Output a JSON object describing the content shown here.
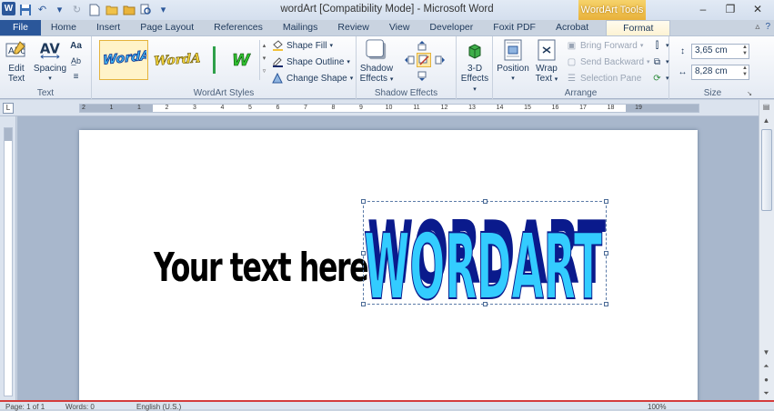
{
  "window": {
    "title": "wordArt [Compatibility Mode]  -  Microsoft Word",
    "contextual_tab_group": "WordArt Tools",
    "min_label": "–",
    "restore_label": "❐",
    "close_label": "✕"
  },
  "qat": {
    "app_icon": "W",
    "save_icon": "💾",
    "undo_icon": "↶",
    "redo_icon": "↻",
    "new_icon": "🗋",
    "open_icon": "📂",
    "folder_icon": "📁",
    "preview_icon": "🔍",
    "customize_icon": "▾"
  },
  "tabs": [
    "File",
    "Home",
    "Insert",
    "Page Layout",
    "References",
    "Mailings",
    "Review",
    "View",
    "Developer",
    "Foxit PDF",
    "Acrobat",
    "Format"
  ],
  "ribbon": {
    "text_group": {
      "label": "Text",
      "edit_text": "Edit\nText",
      "spacing": "Spacing"
    },
    "wordart_styles": {
      "label": "WordArt Styles",
      "thumbs": [
        "WordArt",
        "WordArt",
        "W",
        "W"
      ],
      "shape_fill": "Shape Fill",
      "shape_outline": "Shape Outline",
      "change_shape": "Change Shape"
    },
    "shadow_effects": {
      "label": "Shadow Effects",
      "button": "Shadow\nEffects"
    },
    "three_d": {
      "label": "",
      "button": "3-D\nEffects"
    },
    "arrange": {
      "label": "Arrange",
      "position": "Position",
      "wrap_text": "Wrap\nText",
      "bring_forward": "Bring Forward",
      "send_backward": "Send Backward",
      "selection_pane": "Selection Pane"
    },
    "size": {
      "label": "Size",
      "height": "3,65 cm",
      "width": "8,28 cm"
    }
  },
  "ruler": {
    "ticks": [
      "2",
      "1",
      "1",
      "2",
      "3",
      "4",
      "5",
      "6",
      "7",
      "8",
      "9",
      "10",
      "11",
      "12",
      "13",
      "14",
      "15",
      "16",
      "17",
      "18",
      "19"
    ],
    "corner": "L"
  },
  "document": {
    "body_text": "Your text here",
    "wordart_text": "WORDART"
  },
  "colors": {
    "wordart_fill": "#33ccff",
    "wordart_shadow": "#0a1a8c",
    "file_tab": "#2b579a",
    "tools_tab": "#e8b13a"
  },
  "statusbar": {
    "page": "Page: 1 of 1",
    "words": "Words: 0",
    "language": "English (U.S.)",
    "zoom": "100%"
  }
}
